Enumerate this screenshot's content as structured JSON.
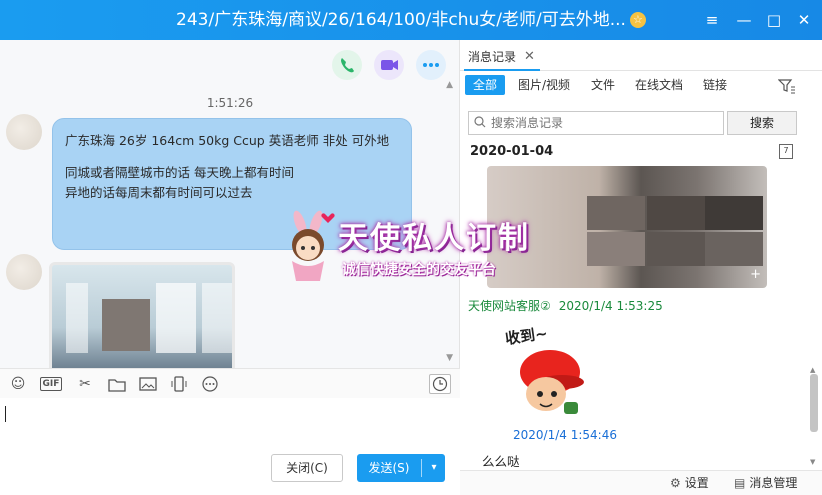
{
  "window": {
    "title": "243/广东珠海/商议/26/164/100/非chu女/老师/可去外地...",
    "title_badge": "☆",
    "controls": {
      "menu": "≡",
      "minimize": "—",
      "maximize": "□",
      "close": "✕"
    }
  },
  "chat": {
    "time": "1:51:26",
    "bubble_lines": [
      "广东珠海 26岁 164cm 50kg Ccup 英语老师 非处 可外地",
      "同城或者隔壁城市的话 每天晚上都有时间",
      "异地的话每周末都有时间可以过去"
    ],
    "call_icons": [
      "phone-icon",
      "video-icon",
      "more-icon"
    ],
    "tools": [
      "emoji-icon",
      "gif-icon",
      "scissors-icon",
      "folder-icon",
      "image-icon",
      "shake-icon",
      "more-tools-icon",
      "history-icon"
    ],
    "gif_label": "GIF",
    "close_button": "关闭(C)",
    "send_button": "发送(S)",
    "send_arrow": "▾"
  },
  "records": {
    "tab_label": "消息记录",
    "tab_close": "✕",
    "filters": [
      "全部",
      "图片/视频",
      "文件",
      "在线文档",
      "链接"
    ],
    "search_placeholder": "搜索消息记录",
    "search_button": "搜索",
    "date": "2020-01-04",
    "calendar_day": "7",
    "entry1_sender": "天使网站客服②",
    "entry1_time": "2020/1/4 1:53:25",
    "sticker_text": "收到~",
    "entry2_time": "2020/1/4 1:54:46",
    "entry2_message": "么么哒",
    "footer_settings": "设置",
    "footer_manage": "消息管理"
  },
  "watermark": {
    "main": "天使私人订制",
    "sub": "诚信快捷安全的交友平台"
  },
  "colors": {
    "accent": "#1a9cf0",
    "bubble": "#a9d3f4",
    "sender_green": "#1a8a3c",
    "time_blue": "#1a6fd6"
  }
}
